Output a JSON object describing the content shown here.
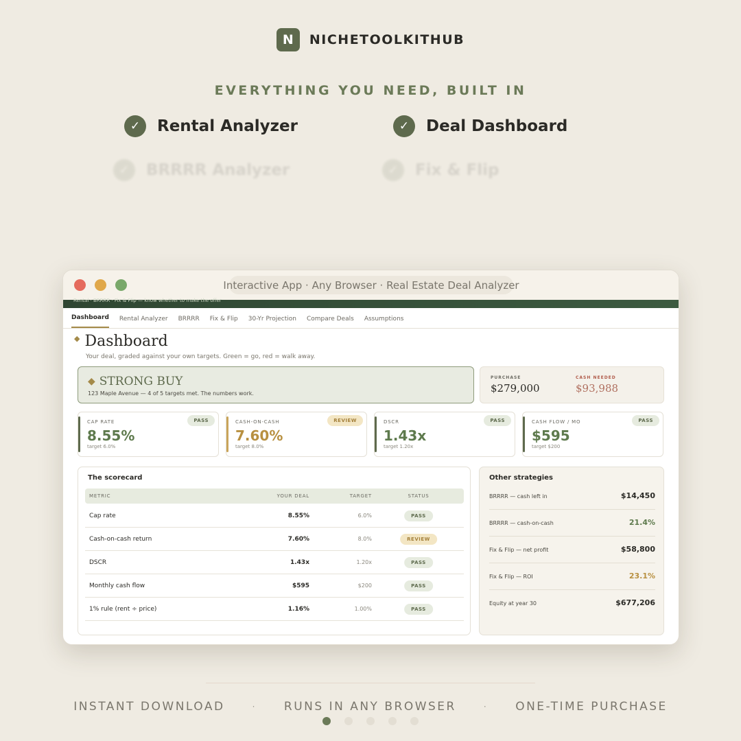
{
  "brand": {
    "logo_letter": "N",
    "name": "NICHETOOLKITHUB"
  },
  "tagline": "EVERYTHING YOU NEED, BUILT IN",
  "features": [
    {
      "label": "Rental Analyzer",
      "faded": false
    },
    {
      "label": "Deal Dashboard",
      "faded": false
    },
    {
      "label": "BRRRR Analyzer",
      "faded": true
    },
    {
      "label": "Fix & Flip",
      "faded": true
    }
  ],
  "window": {
    "url_text": "Interactive App · Any Browser  ·  Real Estate Deal Analyzer",
    "band_text": "Rental · BRRRR · Fix & Flip — know whether to make the offer",
    "tabs": [
      "Dashboard",
      "Rental Analyzer",
      "BRRRR",
      "Fix & Flip",
      "30-Yr Projection",
      "Compare Deals",
      "Assumptions"
    ],
    "active_tab": "Dashboard"
  },
  "dashboard": {
    "title": "Dashboard",
    "subtitle": "Your deal, graded against your own targets. Green = go, red = walk away.",
    "verdict": {
      "title": "STRONG BUY",
      "subtitle": "123 Maple Avenue — 4 of 5 targets met. The numbers work."
    },
    "purchase": {
      "label": "PURCHASE",
      "value": "$279,000"
    },
    "cash_needed": {
      "label": "CASH NEEDED",
      "value": "$93,988"
    },
    "kpis": [
      {
        "label": "CAP RATE",
        "value": "8.55%",
        "target": "target 6.0%",
        "status": "PASS",
        "color": "#5e7a4d"
      },
      {
        "label": "CASH-ON-CASH",
        "value": "7.60%",
        "target": "target 8.0%",
        "status": "REVIEW",
        "color": "#b89040"
      },
      {
        "label": "DSCR",
        "value": "1.43x",
        "target": "target 1.20x",
        "status": "PASS",
        "color": "#5e7a4d"
      },
      {
        "label": "CASH FLOW / MO",
        "value": "$595",
        "target": "target $200",
        "status": "PASS",
        "color": "#5e7a4d"
      }
    ],
    "scorecard": {
      "title": "The scorecard",
      "headers": [
        "METRIC",
        "YOUR DEAL",
        "TARGET",
        "STATUS"
      ],
      "rows": [
        {
          "metric": "Cap rate",
          "deal": "8.55%",
          "target": "6.0%",
          "status": "PASS"
        },
        {
          "metric": "Cash-on-cash return",
          "deal": "7.60%",
          "target": "8.0%",
          "status": "REVIEW"
        },
        {
          "metric": "DSCR",
          "deal": "1.43x",
          "target": "1.20x",
          "status": "PASS"
        },
        {
          "metric": "Monthly cash flow",
          "deal": "$595",
          "target": "$200",
          "status": "PASS"
        },
        {
          "metric": "1% rule (rent ÷ price)",
          "deal": "1.16%",
          "target": "1.00%",
          "status": "PASS"
        }
      ]
    },
    "other": {
      "title": "Other strategies",
      "rows": [
        {
          "label": "BRRRR — cash left in",
          "value": "$14,450",
          "color": "#2b2a26"
        },
        {
          "label": "BRRRR — cash-on-cash",
          "value": "21.4%",
          "color": "#5e7a4d"
        },
        {
          "label": "Fix & Flip — net profit",
          "value": "$58,800",
          "color": "#2b2a26"
        },
        {
          "label": "Fix & Flip — ROI",
          "value": "23.1%",
          "color": "#b89040"
        },
        {
          "label": "Equity at year 30",
          "value": "$677,206",
          "color": "#2b2a26"
        }
      ]
    }
  },
  "footer": {
    "items": [
      "INSTANT DOWNLOAD",
      "RUNS IN ANY BROWSER",
      "ONE-TIME PURCHASE"
    ],
    "separator": "·"
  },
  "pager": {
    "count": 5,
    "active": 1
  },
  "colors": {
    "accent": "#5e6a4d",
    "gold": "#a48a49",
    "background": "#efebe2"
  }
}
